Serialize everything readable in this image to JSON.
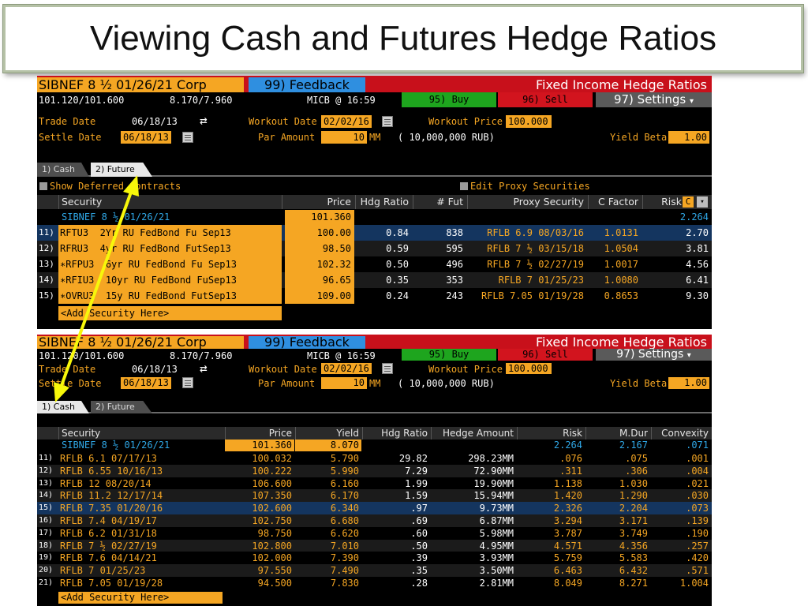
{
  "slide": {
    "title": "Viewing Cash and Futures Hedge Ratios"
  },
  "colors": {
    "amber": "#f5a623",
    "header_red": "#c8101b",
    "buy_green": "#1ea51e",
    "feedback_blue": "#2f8fe0",
    "highlight_row": "#14355f",
    "arrow": "#f7f70a"
  },
  "header": {
    "bond": "SIBNEF 8 ½ 01/26/21 Corp",
    "feedback": "99) Feedback",
    "title": "Fixed Income Hedge Ratios",
    "bid_ask_price": "101.120/101.600",
    "bid_ask_yield": "8.170/7.960",
    "source": "MICB @ 16:59",
    "buy": "95) Buy",
    "sell": "96) Sell",
    "settings": "97) Settings",
    "settings_arrow": "▾",
    "trade_date_label": "Trade Date",
    "trade_date": "06/18/13",
    "settle_date_label": "Settle Date",
    "settle_date": "06/18/13",
    "workout_date_label": "Workout Date",
    "workout_date": "02/02/16",
    "workout_price_label": "Workout Price",
    "workout_price": "100.000",
    "par_amount_label": "Par Amount",
    "par_amount": "10",
    "par_unit": "MM",
    "par_detail": "( 10,000,000 RUB)",
    "yield_beta_label": "Yield Beta",
    "yield_beta": "1.00",
    "refresh_icon": "⇄"
  },
  "tabs": {
    "cash": "1) Cash",
    "future": "2) Future"
  },
  "futures": {
    "show_deferred": "Show Deferred Contracts",
    "edit_proxy": "Edit Proxy Securities",
    "columns": {
      "security": "Security",
      "price": "Price",
      "hdg_ratio": "Hdg Ratio",
      "num_fut": "# Fut",
      "proxy": "Proxy Security",
      "cfactor": "C Factor",
      "risk": "Risk",
      "risk_flag": "C"
    },
    "base": {
      "security": "SIBNEF 8 ½ 01/26/21",
      "price": "101.360",
      "risk": "2.264"
    },
    "rows": [
      {
        "num": "11)",
        "ticker": "RFTU3",
        "desc": "2Yr RU FedBond Fu Sep13",
        "price": "100.00",
        "hdg_ratio": "0.84",
        "num_fut": "838",
        "proxy": "RFLB 6.9 08/03/16",
        "cfactor": "1.0131",
        "risk": "2.70"
      },
      {
        "num": "12)",
        "ticker": "RFRU3",
        "desc": "4yr RU FedBond FutSep13",
        "price": "98.50",
        "hdg_ratio": "0.59",
        "num_fut": "595",
        "proxy": "RFLB 7 ½ 03/15/18",
        "cfactor": "1.0504",
        "risk": "3.81"
      },
      {
        "num": "13)",
        "ticker": "∗RFPU3",
        "desc": "6yr RU FedBond Fu Sep13",
        "price": "102.32",
        "hdg_ratio": "0.50",
        "num_fut": "496",
        "proxy": "RFLB 7 ½ 02/27/19",
        "cfactor": "1.0017",
        "risk": "4.56"
      },
      {
        "num": "14)",
        "ticker": "∗RFIU3",
        "desc": "10yr RU FedBond FuSep13",
        "price": "96.65",
        "hdg_ratio": "0.35",
        "num_fut": "353",
        "proxy": "RFLB 7 01/25/23",
        "cfactor": "1.0080",
        "risk": "6.41"
      },
      {
        "num": "15)",
        "ticker": "∗OVRU3",
        "desc": "15y RU FedBond FutSep13",
        "price": "109.00",
        "hdg_ratio": "0.24",
        "num_fut": "243",
        "proxy": "RFLB 7.05 01/19/28",
        "cfactor": "0.8653",
        "risk": "9.30"
      }
    ],
    "add_security": "<Add Security Here>"
  },
  "cash": {
    "columns": {
      "security": "Security",
      "price": "Price",
      "yield": "Yield",
      "hdg_ratio": "Hdg Ratio",
      "hedge_amount": "Hedge Amount",
      "risk": "Risk",
      "mdur": "M.Dur",
      "convexity": "Convexity"
    },
    "base": {
      "security": "SIBNEF 8 ½ 01/26/21",
      "price": "101.360",
      "yield": "8.070",
      "risk": "2.264",
      "mdur": "2.167",
      "convexity": ".071"
    },
    "rows": [
      {
        "num": "11)",
        "security": "RFLB 6.1 07/17/13",
        "price": "100.032",
        "yield": "5.790",
        "hdg_ratio": "29.82",
        "hedge_amount": "298.23MM",
        "risk": ".076",
        "mdur": ".075",
        "convexity": ".001"
      },
      {
        "num": "12)",
        "security": "RFLB 6.55 10/16/13",
        "price": "100.222",
        "yield": "5.990",
        "hdg_ratio": "7.29",
        "hedge_amount": "72.90MM",
        "risk": ".311",
        "mdur": ".306",
        "convexity": ".004"
      },
      {
        "num": "13)",
        "security": "RFLB 12 08/20/14",
        "price": "106.600",
        "yield": "6.160",
        "hdg_ratio": "1.99",
        "hedge_amount": "19.90MM",
        "risk": "1.138",
        "mdur": "1.030",
        "convexity": ".021"
      },
      {
        "num": "14)",
        "security": "RFLB 11.2 12/17/14",
        "price": "107.350",
        "yield": "6.170",
        "hdg_ratio": "1.59",
        "hedge_amount": "15.94MM",
        "risk": "1.420",
        "mdur": "1.290",
        "convexity": ".030"
      },
      {
        "num": "15)",
        "security": "RFLB 7.35 01/20/16",
        "price": "102.600",
        "yield": "6.340",
        "hdg_ratio": ".97",
        "hedge_amount": "9.73MM",
        "risk": "2.326",
        "mdur": "2.204",
        "convexity": ".073"
      },
      {
        "num": "16)",
        "security": "RFLB 7.4 04/19/17",
        "price": "102.750",
        "yield": "6.680",
        "hdg_ratio": ".69",
        "hedge_amount": "6.87MM",
        "risk": "3.294",
        "mdur": "3.171",
        "convexity": ".139"
      },
      {
        "num": "17)",
        "security": "RFLB 6.2 01/31/18",
        "price": "98.750",
        "yield": "6.620",
        "hdg_ratio": ".60",
        "hedge_amount": "5.98MM",
        "risk": "3.787",
        "mdur": "3.749",
        "convexity": ".190"
      },
      {
        "num": "18)",
        "security": "RFLB 7 ½ 02/27/19",
        "price": "102.800",
        "yield": "7.010",
        "hdg_ratio": ".50",
        "hedge_amount": "4.95MM",
        "risk": "4.571",
        "mdur": "4.356",
        "convexity": ".257"
      },
      {
        "num": "19)",
        "security": "RFLB 7.6 04/14/21",
        "price": "102.000",
        "yield": "7.390",
        "hdg_ratio": ".39",
        "hedge_amount": "3.93MM",
        "risk": "5.759",
        "mdur": "5.583",
        "convexity": ".420"
      },
      {
        "num": "20)",
        "security": "RFLB 7 01/25/23",
        "price": "97.550",
        "yield": "7.490",
        "hdg_ratio": ".35",
        "hedge_amount": "3.50MM",
        "risk": "6.463",
        "mdur": "6.432",
        "convexity": ".571"
      },
      {
        "num": "21)",
        "security": "RFLB 7.05 01/19/28",
        "price": "94.500",
        "yield": "7.830",
        "hdg_ratio": ".28",
        "hedge_amount": "2.81MM",
        "risk": "8.049",
        "mdur": "8.271",
        "convexity": "1.004"
      }
    ],
    "add_security": "<Add Security Here>"
  }
}
